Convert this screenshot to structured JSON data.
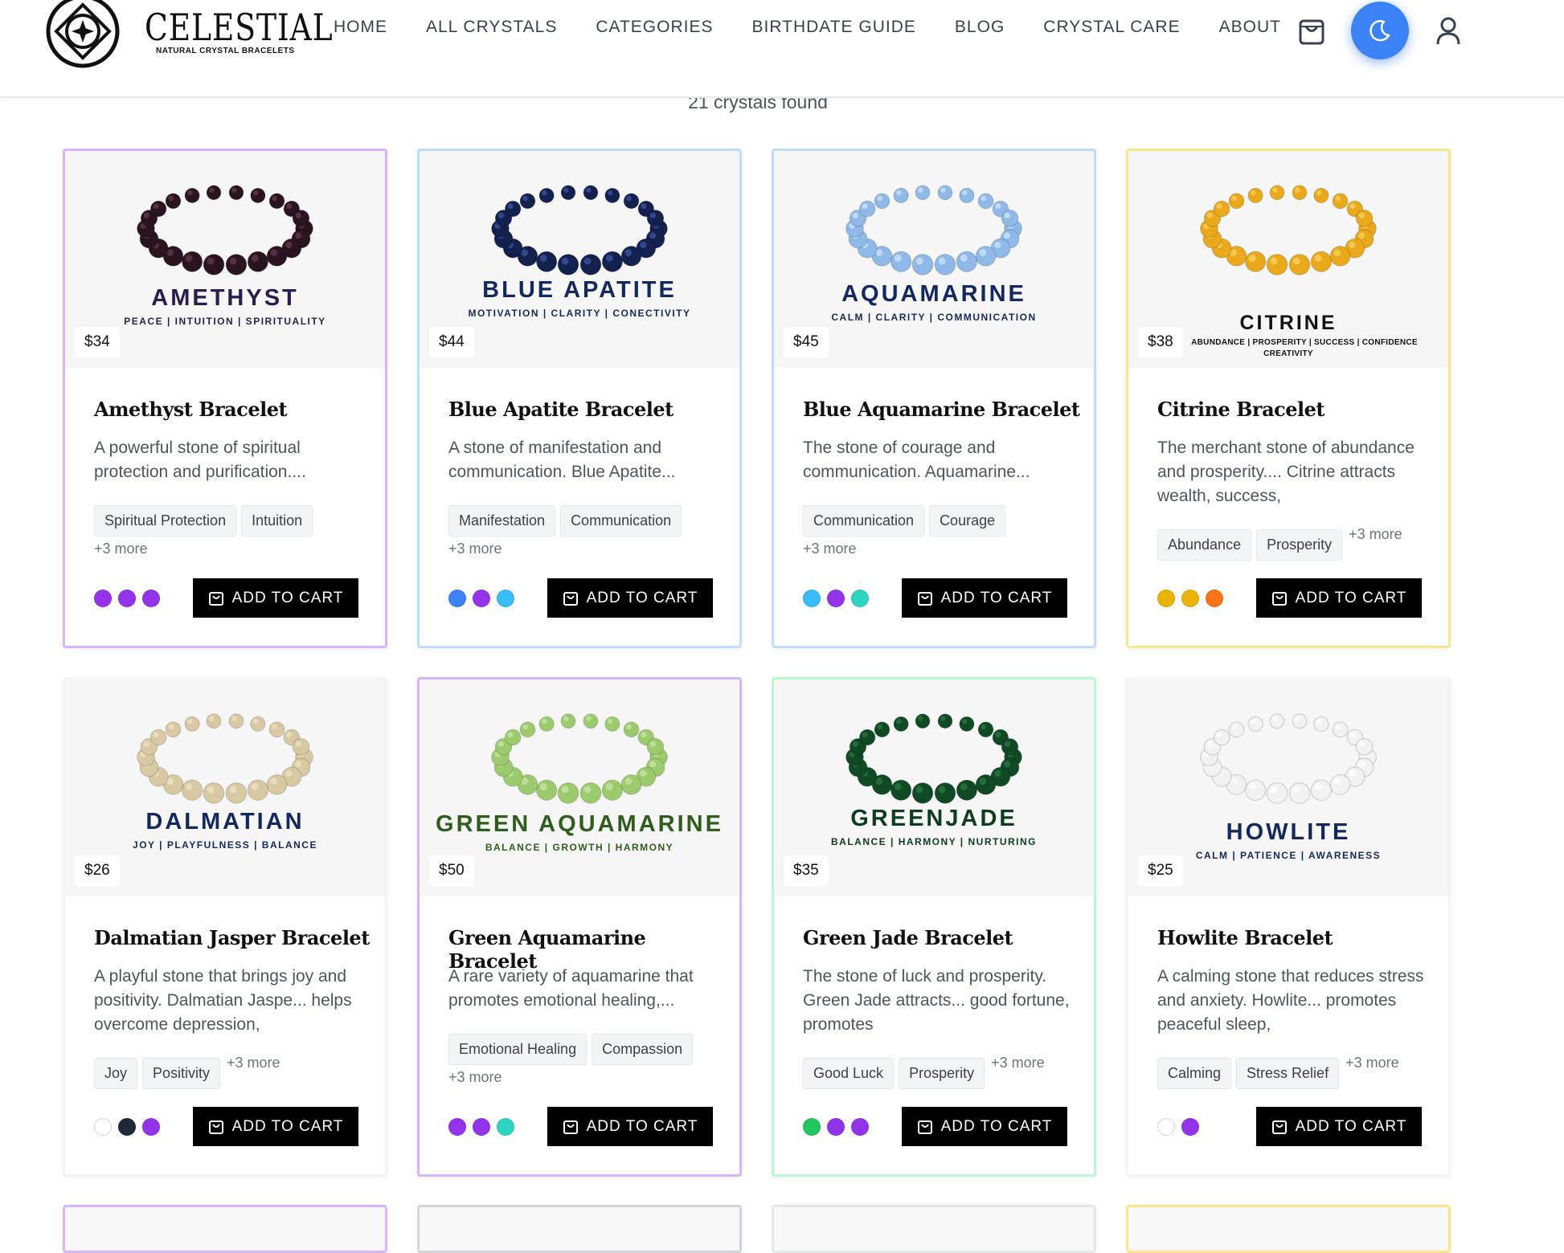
{
  "brand": {
    "name": "CELESTIAL",
    "tagline": "NATURAL CRYSTAL BRACELETS"
  },
  "nav": [
    "HOME",
    "ALL CRYSTALS",
    "CATEGORIES",
    "BIRTHDATE GUIDE",
    "BLOG",
    "CRYSTAL CARE",
    "ABOUT"
  ],
  "header_icons": {
    "cart": "shopping-bag-icon",
    "theme": "moon-icon",
    "user": "user-icon"
  },
  "results_count": "21 crystals found",
  "add_to_cart_label": "ADD TO CART",
  "products": [
    {
      "stone": "AMETHYST",
      "stone_sub": "PEACE | INTUITION | SPIRITUALITY",
      "stone_color": "#2b1d4e",
      "price": "$34",
      "title": "Amethyst Bracelet",
      "desc": "A powerful stone of spiritual protection and purification....",
      "tags": [
        "Spiritual Protection",
        "Intuition"
      ],
      "more": "+3 more",
      "colors": [
        "#9333ea",
        "#9333ea",
        "#9333ea"
      ],
      "border": "#d8b4fe",
      "bead": "#2a1420",
      "bead_hi": "#6b3a55"
    },
    {
      "stone": "BLUE APATITE",
      "stone_sub": "MOTIVATION | CLARITY | CONECTIVITY",
      "stone_color": "#13295e",
      "price": "$44",
      "title": "Blue Apatite Bracelet",
      "desc": "A stone of manifestation and communication. Blue Apatite...",
      "tags": [
        "Manifestation",
        "Communication"
      ],
      "more": "+3 more",
      "colors": [
        "#3b82f6",
        "#9333ea",
        "#38bdf8"
      ],
      "border": "#bfdbfe",
      "bead": "#14214f",
      "bead_hi": "#3f5aa8"
    },
    {
      "stone": "AQUAMARINE",
      "stone_sub": "CALM | CLARITY | COMMUNICATION",
      "stone_color": "#13295e",
      "price": "$45",
      "title": "Blue Aquamarine Bracelet",
      "desc": "The stone of courage and communication. Aquamarine...",
      "tags": [
        "Communication",
        "Courage"
      ],
      "more": "+3 more",
      "colors": [
        "#38bdf8",
        "#9333ea",
        "#2dd4bf"
      ],
      "border": "#bfdbfe",
      "bead": "#8fb9e8",
      "bead_hi": "#d4e7fa"
    },
    {
      "stone": "CITRINE",
      "stone_sub": "ABUNDANCE | PROSPERITY | SUCCESS | CONFIDENCE",
      "stone_sub2": "CREATIVITY",
      "stone_color": "#111111",
      "price": "$38",
      "title": "Citrine Bracelet",
      "desc": "The merchant stone of abundance and prosperity.... Citrine attracts wealth, success,",
      "tags": [
        "Abundance",
        "Prosperity"
      ],
      "more": "+3 more",
      "colors": [
        "#eab308",
        "#eab308",
        "#f97316"
      ],
      "border": "#fde68a",
      "bead": "#e9a91b",
      "bead_hi": "#fbd66a"
    },
    {
      "stone": "DALMATIAN",
      "stone_sub": "JOY | PLAYFULNESS | BALANCE",
      "stone_color": "#13295e",
      "price": "$26",
      "title": "Dalmatian Jasper Bracelet",
      "desc": "A playful stone that brings joy and positivity. Dalmatian Jaspe... helps overcome depression,",
      "tags": [
        "Joy",
        "Positivity"
      ],
      "more": "+3 more",
      "colors": [
        "#ffffff",
        "#1f2937",
        "#9333ea"
      ],
      "border": "#f3f4f6",
      "bead": "#d9c9a3",
      "bead_hi": "#efe4c8"
    },
    {
      "stone": "GREEN AQUAMARINE",
      "stone_sub": "BALANCE | GROWTH | HARMONY",
      "stone_color": "#2f5d1c",
      "price": "$50",
      "title": "Green Aquamarine Bracelet",
      "desc": "A rare variety of aquamarine that promotes emotional healing,...",
      "tags": [
        "Emotional Healing",
        "Compassion"
      ],
      "more": "+3 more",
      "colors": [
        "#9333ea",
        "#9333ea",
        "#2dd4bf"
      ],
      "border": "#d8b4fe",
      "bead": "#9ccb6e",
      "bead_hi": "#cde7ad"
    },
    {
      "stone": "GREENJADE",
      "stone_sub": "BALANCE | HARMONY | NURTURING",
      "stone_color": "#0f3b1f",
      "price": "$35",
      "title": "Green Jade Bracelet",
      "desc": "The stone of luck and prosperity. Green Jade attracts... good fortune, promotes",
      "tags": [
        "Good Luck",
        "Prosperity"
      ],
      "more": "+3 more",
      "colors": [
        "#22c55e",
        "#9333ea",
        "#9333ea"
      ],
      "border": "#bbf7d0",
      "bead": "#0f4a24",
      "bead_hi": "#2f7a45"
    },
    {
      "stone": "HOWLITE",
      "stone_sub": "CALM | PATIENCE | AWARENESS",
      "stone_color": "#13295e",
      "price": "$25",
      "title": "Howlite Bracelet",
      "desc": "A calming stone that reduces stress and anxiety. Howlite... promotes peaceful sleep,",
      "tags": [
        "Calming",
        "Stress Relief"
      ],
      "more": "+3 more",
      "colors": [
        "#ffffff",
        "#9333ea"
      ],
      "border": "#f3f4f6",
      "bead": "#f2f2f2",
      "bead_hi": "#ffffff"
    }
  ]
}
